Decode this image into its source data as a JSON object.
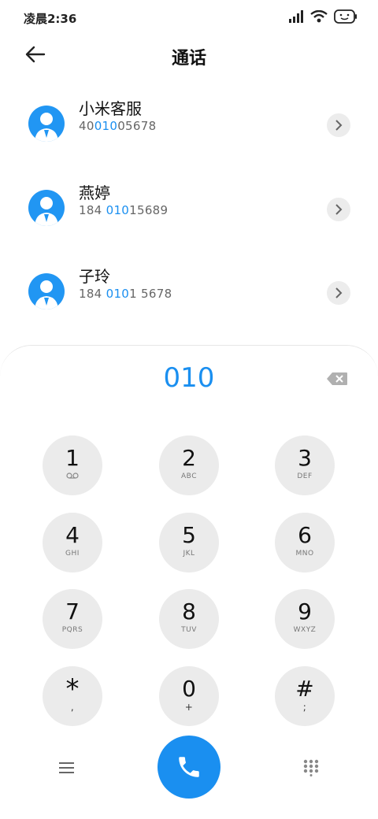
{
  "status_bar": {
    "time": "凌晨2:36",
    "icons": [
      "signal-icon",
      "wifi-icon",
      "battery-icon"
    ]
  },
  "header": {
    "title": "通话",
    "back_icon": "arrow-left-icon"
  },
  "contacts": [
    {
      "name": "小米客服",
      "number_pre": "40",
      "number_hl": "010",
      "number_post": "05678"
    },
    {
      "name": "燕婷",
      "number_pre": "184 ",
      "number_hl": "010",
      "number_post": "15689"
    },
    {
      "name": "子玲",
      "number_pre": "184 ",
      "number_hl": "010",
      "number_post": "1 5678"
    }
  ],
  "dialer": {
    "display": "010",
    "keys": [
      {
        "digit": "1",
        "letters": "ꝏ"
      },
      {
        "digit": "2",
        "letters": "ABC"
      },
      {
        "digit": "3",
        "letters": "DEF"
      },
      {
        "digit": "4",
        "letters": "GHI"
      },
      {
        "digit": "5",
        "letters": "JKL"
      },
      {
        "digit": "6",
        "letters": "MNO"
      },
      {
        "digit": "7",
        "letters": "PQRS"
      },
      {
        "digit": "8",
        "letters": "TUV"
      },
      {
        "digit": "9",
        "letters": "WXYZ"
      },
      {
        "digit": "*",
        "letters": ","
      },
      {
        "digit": "0",
        "letters": "+"
      },
      {
        "digit": "#",
        "letters": ";"
      }
    ]
  },
  "colors": {
    "accent": "#1a8ff0",
    "key_bg": "#ebebeb",
    "avatar": "#2196f3"
  }
}
